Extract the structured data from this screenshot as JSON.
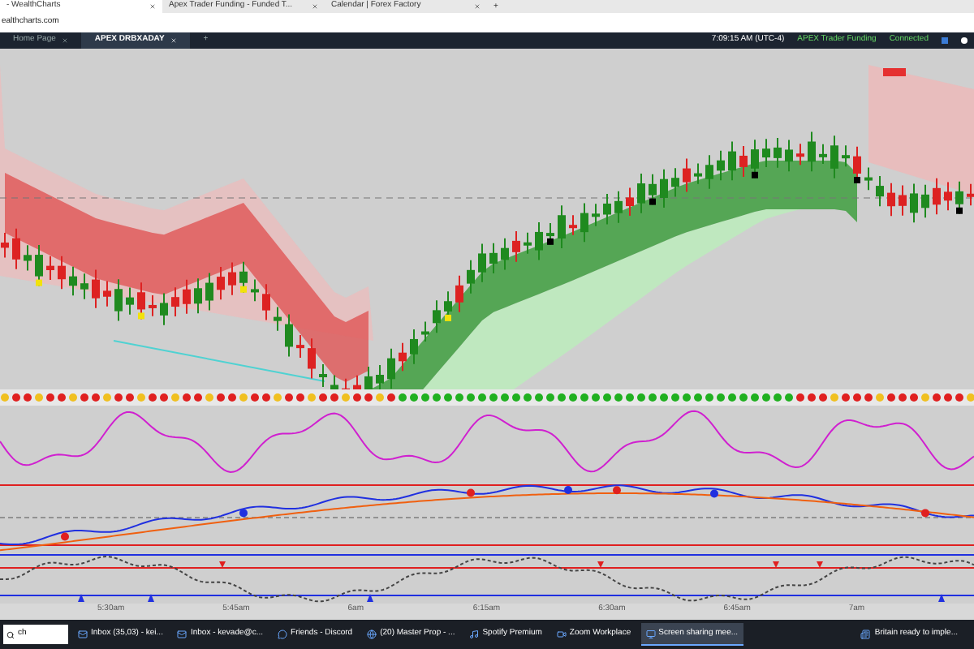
{
  "browser_tabs": [
    {
      "label": "- WealthCharts",
      "selected": true
    },
    {
      "label": "Apex Trader Funding - Funded T...",
      "selected": false
    },
    {
      "label": "Calendar | Forex Factory",
      "selected": false
    }
  ],
  "new_tab": "+",
  "address": "ealthcharts.com",
  "app_tabs": [
    {
      "label": "Home Page",
      "selected": false
    },
    {
      "label": "APEX DRBXADAY",
      "selected": true
    }
  ],
  "add_tab": "+",
  "status": {
    "time": "7:09:15 AM (UTC-4)",
    "account": "APEX Trader Funding",
    "connection": "Connected"
  },
  "time_axis": [
    "5:30am",
    "5:45am",
    "6am",
    "6:15am",
    "6:30am",
    "6:45am",
    "7am"
  ],
  "taskbar": {
    "search": "ch",
    "apps": [
      {
        "label": "Inbox (35,03) - kei...",
        "selected": false
      },
      {
        "label": "Inbox - kevade@c...",
        "selected": false
      },
      {
        "label": "Friends - Discord",
        "selected": false
      },
      {
        "label": "(20) Master Prop - ...",
        "selected": false
      },
      {
        "label": "Spotify Premium",
        "selected": false
      },
      {
        "label": "Zoom Workplace",
        "selected": false
      },
      {
        "label": "Screen sharing mee...",
        "selected": true
      }
    ],
    "news": "Britain ready to imple..."
  }
}
